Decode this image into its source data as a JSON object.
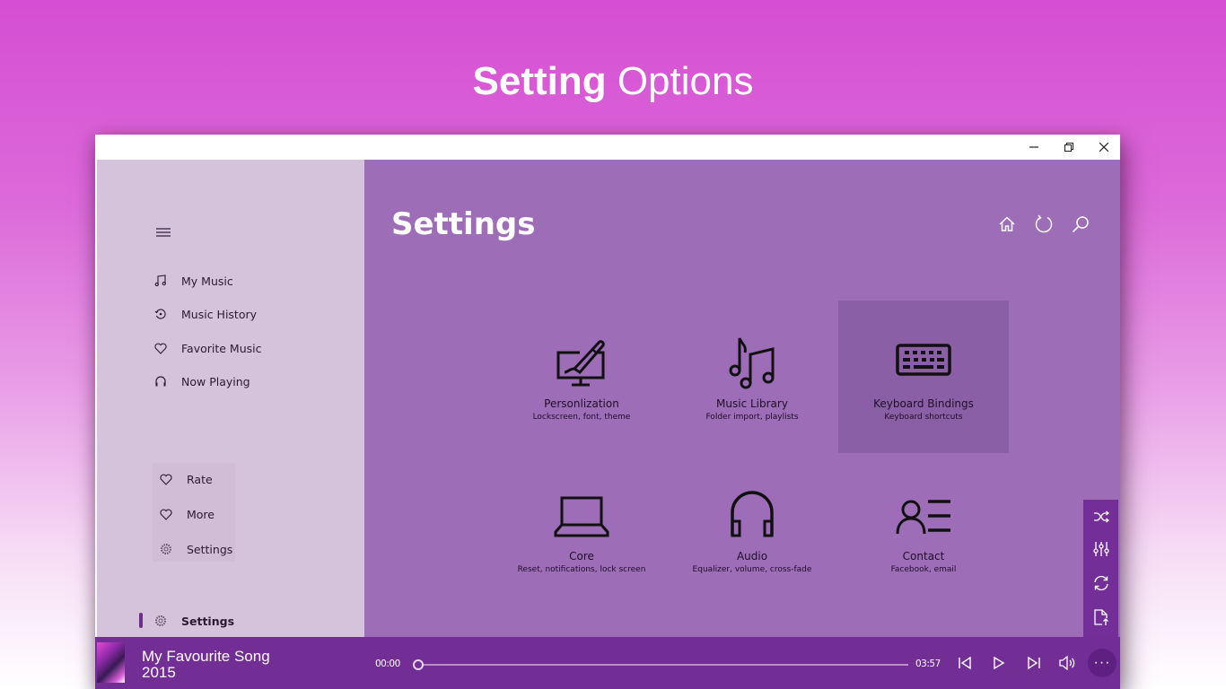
{
  "hero": {
    "bold": "Setting",
    "rest": " Options"
  },
  "window_controls": {
    "minimize": "minimize-icon",
    "restore": "restore-icon",
    "close": "close-icon"
  },
  "sidebar": {
    "menu_icon": "hamburger-icon",
    "items": [
      {
        "label": "My Music",
        "icon": "music-note-icon"
      },
      {
        "label": "Music History",
        "icon": "history-icon"
      },
      {
        "label": "Favorite Music",
        "icon": "heart-icon"
      },
      {
        "label": "Now Playing",
        "icon": "headphones-icon"
      }
    ],
    "group": [
      {
        "label": "Rate",
        "icon": "heart-icon"
      },
      {
        "label": "More",
        "icon": "heart-icon"
      },
      {
        "label": "Settings",
        "icon": "gear-icon"
      }
    ],
    "active": {
      "label": "Settings",
      "icon": "gear-icon"
    }
  },
  "main": {
    "title": "Settings",
    "top_icons": [
      "home-icon",
      "refresh-icon",
      "search-icon"
    ],
    "tiles": [
      {
        "name": "Personlization",
        "sub": "Lockscreen, font, theme",
        "icon": "monitor-brush-icon",
        "highlighted": false
      },
      {
        "name": "Music Library",
        "sub": "Folder import, playlists",
        "icon": "music-notes-icon",
        "highlighted": false
      },
      {
        "name": "Keyboard Bindings",
        "sub": "Keyboard shortcuts",
        "icon": "keyboard-icon",
        "highlighted": true
      },
      {
        "name": "Core",
        "sub": "Reset, notifications, lock screen",
        "icon": "laptop-icon",
        "highlighted": false
      },
      {
        "name": "Audio",
        "sub": "Equalizer, volume, cross-fade",
        "icon": "headphones-icon",
        "highlighted": false
      },
      {
        "name": "Contact",
        "sub": "Facebook, email",
        "icon": "contact-icon",
        "highlighted": false
      }
    ]
  },
  "side_tools": [
    "shuffle-icon",
    "equalizer-icon",
    "repeat-icon",
    "export-file-icon"
  ],
  "player": {
    "song_title": "My Favourite Song",
    "song_year": "2015",
    "elapsed": "00:00",
    "duration": "03:57",
    "progress": 0,
    "controls": [
      "previous-icon",
      "play-icon",
      "next-icon",
      "volume-icon"
    ],
    "more_label": "···"
  },
  "colors": {
    "background_top": "#d54ed3",
    "sidebar": "#d4c3da",
    "main": "#9d6db7",
    "tile_highlight": "#8b5fa6",
    "player": "#732e96",
    "accent": "#6f2d91"
  }
}
